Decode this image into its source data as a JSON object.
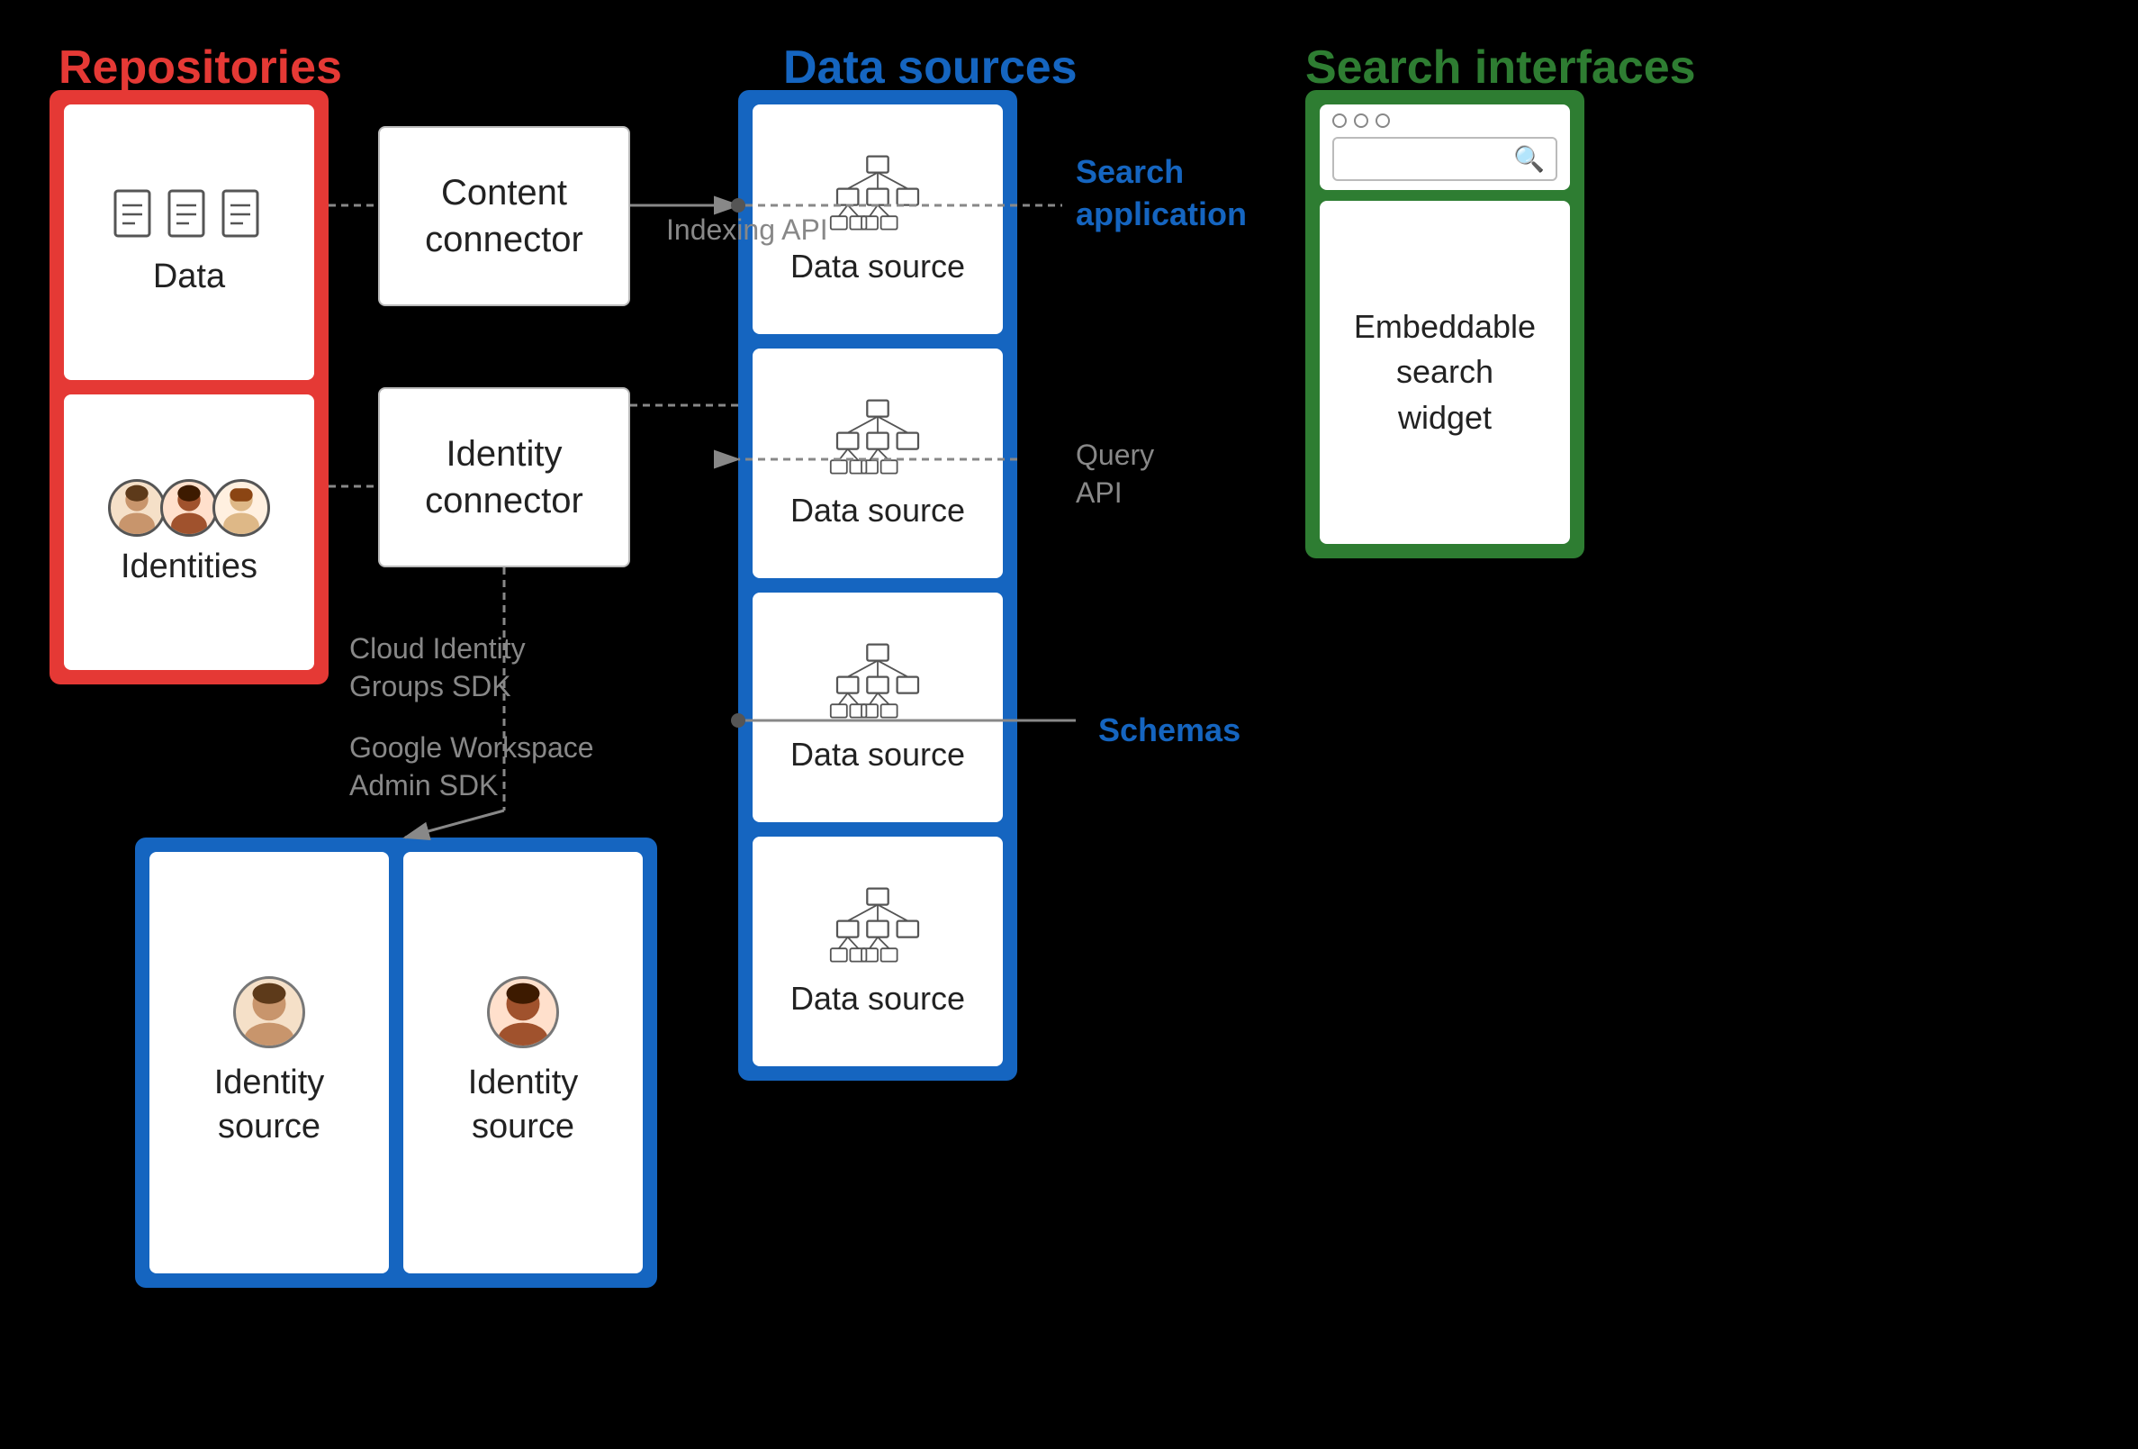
{
  "labels": {
    "repositories": "Repositories",
    "data_sources": "Data sources",
    "search_interfaces": "Search interfaces",
    "data": "Data",
    "identities": "Identities",
    "content_connector": "Content\nconnector",
    "identity_connector": "Identity\nconnector",
    "indexing_api": "Indexing API",
    "query_api": "Query\nAPI",
    "cloud_identity_sdk": "Cloud Identity\nGroups SDK",
    "google_workspace_sdk": "Google Workspace\nAdmin SDK",
    "data_source": "Data source",
    "search_application": "Search\napplication",
    "schemas": "Schemas",
    "search": "Search",
    "embeddable_search_widget": "Embeddable\nsearch\nwidget",
    "identity_source_1": "Identity\nsource",
    "identity_source_2": "Identity\nsource"
  },
  "colors": {
    "repositories_red": "#e53935",
    "data_sources_blue": "#1565c0",
    "search_interfaces_green": "#2e7d32",
    "black_bg": "#000000",
    "white": "#ffffff",
    "gray_text": "#888888",
    "dark_text": "#222222"
  }
}
